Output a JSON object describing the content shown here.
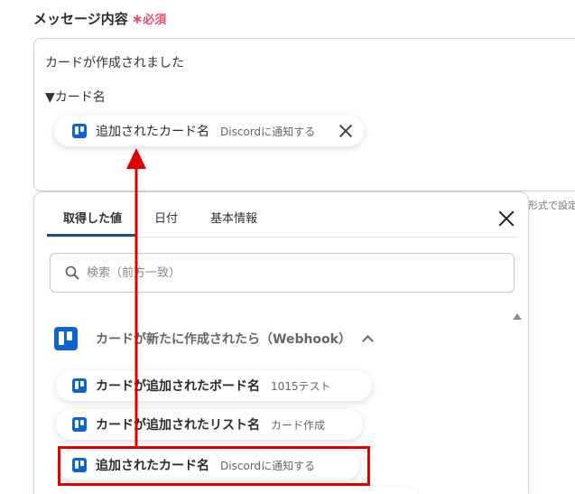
{
  "form": {
    "label": "メッセージ内容",
    "required_mark": "∗",
    "required_text": "必須",
    "message_line1": "カードが作成されました",
    "message_line2": "▼カード名",
    "inserted_chip": {
      "label": "追加されたカード名",
      "sub": "Discordに通知する"
    },
    "side_note": "形式で設定"
  },
  "panel": {
    "tabs": [
      {
        "label": "取得した値",
        "active": true
      },
      {
        "label": "日付"
      },
      {
        "label": "基本情報"
      }
    ],
    "search": {
      "placeholder": "検索（前方一致）"
    },
    "section": {
      "title": "カードが新たに作成されたら（Webhook）",
      "icon": "trello-icon"
    },
    "items": [
      {
        "label": "カードが追加されたボード名",
        "sub": "1015テスト",
        "icon": "trello-icon"
      },
      {
        "label": "カードが追加されたリスト名",
        "sub": "カード作成",
        "icon": "trello-icon"
      },
      {
        "label": "追加されたカード名",
        "sub": "Discordに通知する",
        "icon": "trello-icon",
        "highlighted": true
      }
    ]
  },
  "colors": {
    "accent": "#1b4e86",
    "trello": "#0f63d1",
    "required": "#e84d6a",
    "annotation": "#e00000"
  }
}
